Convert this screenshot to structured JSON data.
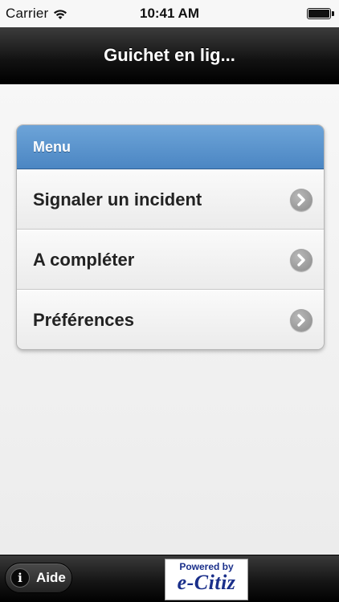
{
  "status_bar": {
    "carrier": "Carrier",
    "time": "10:41 AM",
    "wifi_icon": "wifi-icon",
    "battery_icon": "battery-icon"
  },
  "header": {
    "title": "Guichet en lig..."
  },
  "menu": {
    "title": "Menu",
    "items": [
      {
        "label": "Signaler un incident",
        "icon": "chevron-right-icon"
      },
      {
        "label": "A compléter",
        "icon": "chevron-right-icon"
      },
      {
        "label": "Préférences",
        "icon": "chevron-right-icon"
      }
    ]
  },
  "footer": {
    "help_label": "Aide",
    "help_icon": "info-icon",
    "help_icon_glyph": "i",
    "logo_line1": "Powered by",
    "logo_line2": "e-Citiz"
  },
  "colors": {
    "menu_header": "#5b95cf",
    "header_bg": "#111111",
    "logo_text": "#1a2f8a"
  }
}
